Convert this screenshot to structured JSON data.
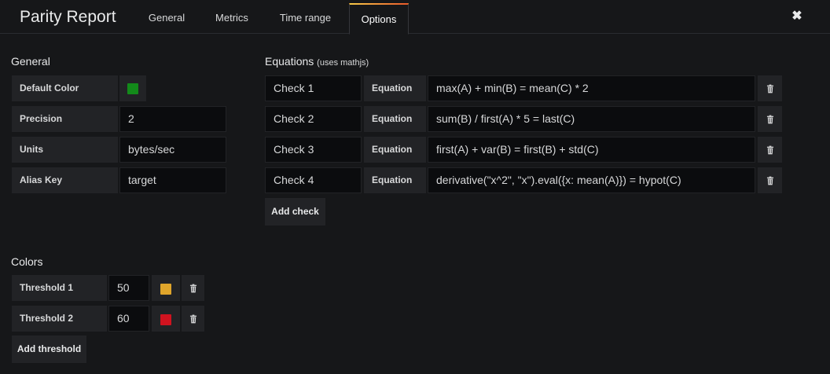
{
  "header": {
    "title": "Parity Report",
    "tabs": [
      {
        "label": "General",
        "active": false
      },
      {
        "label": "Metrics",
        "active": false
      },
      {
        "label": "Time range",
        "active": false
      },
      {
        "label": "Options",
        "active": true
      }
    ],
    "close_glyph": "✖"
  },
  "general": {
    "title": "General",
    "default_color": {
      "label": "Default Color",
      "color": "#138a1a"
    },
    "precision": {
      "label": "Precision",
      "value": "2"
    },
    "units": {
      "label": "Units",
      "value": "bytes/sec"
    },
    "alias_key": {
      "label": "Alias Key",
      "value": "target"
    }
  },
  "equations": {
    "title": "Equations",
    "subtitle": "(uses mathjs)",
    "equation_label": "Equation",
    "items": [
      {
        "name": "Check 1",
        "equation": "max(A) + min(B) = mean(C) * 2"
      },
      {
        "name": "Check 2",
        "equation": "sum(B) / first(A) * 5 = last(C)"
      },
      {
        "name": "Check 3",
        "equation": "first(A) + var(B) = first(B) + std(C)"
      },
      {
        "name": "Check 4",
        "equation": "derivative(\"x^2\", \"x\").eval({x: mean(A)}) = hypot(C)"
      }
    ],
    "add_label": "Add check"
  },
  "colors": {
    "title": "Colors",
    "thresholds": [
      {
        "label": "Threshold 1",
        "value": "50",
        "color": "#e0a52b"
      },
      {
        "label": "Threshold 2",
        "value": "60",
        "color": "#d0131f"
      }
    ],
    "add_label": "Add threshold"
  }
}
